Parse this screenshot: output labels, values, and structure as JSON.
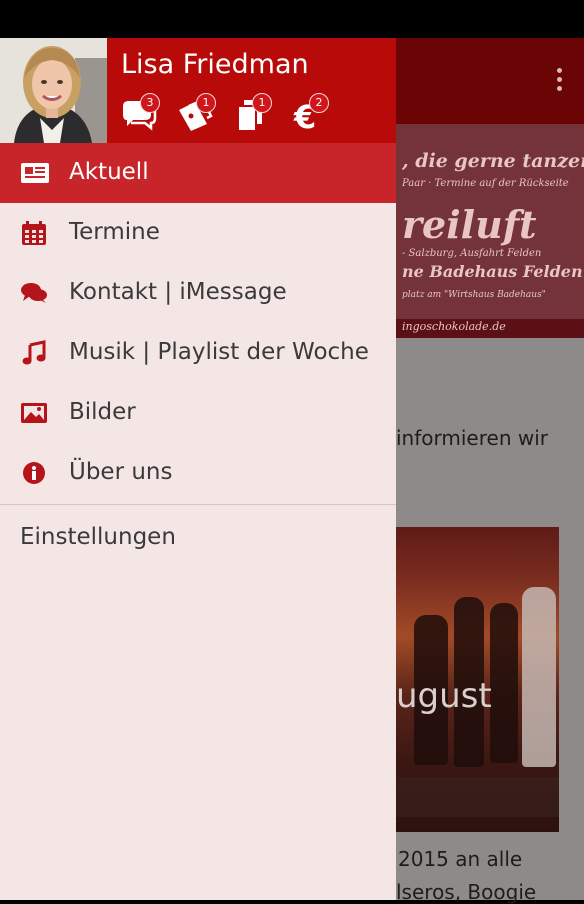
{
  "user": {
    "name": "Lisa Friedman"
  },
  "header_icons": [
    {
      "icon": "chat-bubbles-icon",
      "badge": "3"
    },
    {
      "icon": "tickets-icon",
      "badge": "1"
    },
    {
      "icon": "documents-icon",
      "badge": "1"
    },
    {
      "icon": "euro-icon",
      "badge": "2"
    }
  ],
  "nav": {
    "items": [
      {
        "label": "Aktuell",
        "icon": "newspaper-icon",
        "active": true
      },
      {
        "label": "Termine",
        "icon": "calendar-icon"
      },
      {
        "label": "Kontakt | iMessage",
        "icon": "chat-icon"
      },
      {
        "label": "Musik | Playlist der Woche",
        "icon": "music-note-icon"
      },
      {
        "label": "Bilder",
        "icon": "image-icon"
      },
      {
        "label": "Über uns",
        "icon": "info-icon"
      }
    ],
    "settings_label": "Einstellungen"
  },
  "background": {
    "banner_lines": [
      ", die gerne tanzen",
      "Paar · Termine auf der Rückseite",
      "reiluft",
      "- Salzburg, Ausfahrt Felden",
      "ne Badehaus Felden",
      "platz am \"Wirtshaus Badehaus\"",
      "ingoschokolade.de"
    ],
    "text_1": "informieren wir",
    "event_title": "ugust",
    "text_2": "2015 an alle",
    "text_3": "lseros, Boogie"
  },
  "colors": {
    "primary": "#b90a0a",
    "active_item": "#c8252a",
    "drawer_bg": "#f5e6e6",
    "icon": "#b5141a"
  }
}
